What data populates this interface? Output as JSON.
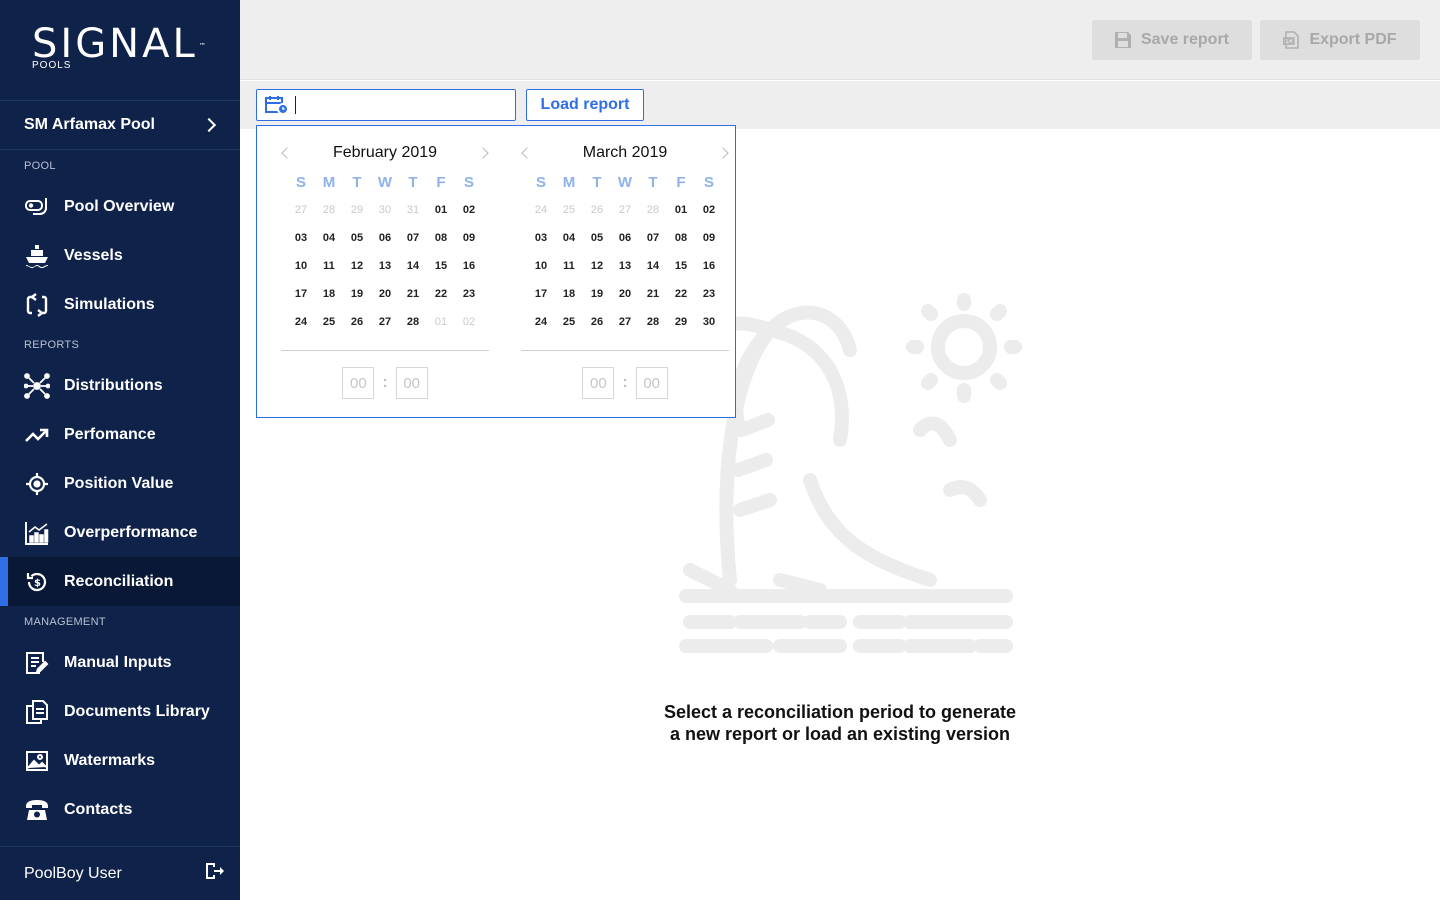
{
  "brand": {
    "name": "SIGNAL",
    "tm": "™",
    "sub": "POOLS"
  },
  "pool_selector": {
    "label": "SM Arfamax Pool"
  },
  "sidebar": {
    "sections": [
      {
        "label": "POOL",
        "items": [
          {
            "label": "Pool Overview",
            "icon": "snorkel-icon"
          },
          {
            "label": "Vessels",
            "icon": "ship-icon"
          },
          {
            "label": "Simulations",
            "icon": "cycle-icon"
          }
        ]
      },
      {
        "label": "REPORTS",
        "items": [
          {
            "label": "Distributions",
            "icon": "network-icon"
          },
          {
            "label": "Perfomance",
            "icon": "trend-icon"
          },
          {
            "label": "Position Value",
            "icon": "target-icon"
          },
          {
            "label": "Overperformance",
            "icon": "bar-chart-icon"
          },
          {
            "label": "Reconciliation",
            "icon": "reconcile-icon",
            "active": true
          }
        ]
      },
      {
        "label": "MANAGEMENT",
        "items": [
          {
            "label": "Manual Inputs",
            "icon": "edit-doc-icon"
          },
          {
            "label": "Documents Library",
            "icon": "documents-icon"
          },
          {
            "label": "Watermarks",
            "icon": "image-icon"
          },
          {
            "label": "Contacts",
            "icon": "phone-icon"
          }
        ]
      }
    ]
  },
  "user": {
    "name": "PoolBoy User"
  },
  "toolbar": {
    "save_label": "Save report",
    "export_label": "Export PDF"
  },
  "filter": {
    "date_value": "",
    "load_label": "Load report"
  },
  "calendar": {
    "dows": [
      "S",
      "M",
      "T",
      "W",
      "T",
      "F",
      "S"
    ],
    "months": [
      {
        "title": "February 2019",
        "weeks": [
          [
            [
              "27",
              1
            ],
            [
              "28",
              1
            ],
            [
              "29",
              1
            ],
            [
              "30",
              1
            ],
            [
              "31",
              1
            ],
            [
              "01",
              0
            ],
            [
              "02",
              0
            ]
          ],
          [
            [
              "03",
              0
            ],
            [
              "04",
              0
            ],
            [
              "05",
              0
            ],
            [
              "06",
              0
            ],
            [
              "07",
              0
            ],
            [
              "08",
              0
            ],
            [
              "09",
              0
            ]
          ],
          [
            [
              "10",
              0
            ],
            [
              "11",
              0
            ],
            [
              "12",
              0
            ],
            [
              "13",
              0
            ],
            [
              "14",
              0
            ],
            [
              "15",
              0
            ],
            [
              "16",
              0
            ]
          ],
          [
            [
              "17",
              0
            ],
            [
              "18",
              0
            ],
            [
              "19",
              0
            ],
            [
              "20",
              0
            ],
            [
              "21",
              0
            ],
            [
              "22",
              0
            ],
            [
              "23",
              0
            ]
          ],
          [
            [
              "24",
              0
            ],
            [
              "25",
              0
            ],
            [
              "26",
              0
            ],
            [
              "27",
              0
            ],
            [
              "28",
              0
            ],
            [
              "01",
              1
            ],
            [
              "02",
              1
            ]
          ]
        ],
        "time": {
          "hours": "00",
          "minutes": "00"
        }
      },
      {
        "title": "March 2019",
        "weeks": [
          [
            [
              "24",
              1
            ],
            [
              "25",
              1
            ],
            [
              "26",
              1
            ],
            [
              "27",
              1
            ],
            [
              "28",
              1
            ],
            [
              "01",
              0
            ],
            [
              "02",
              0
            ]
          ],
          [
            [
              "03",
              0
            ],
            [
              "04",
              0
            ],
            [
              "05",
              0
            ],
            [
              "06",
              0
            ],
            [
              "07",
              0
            ],
            [
              "08",
              0
            ],
            [
              "09",
              0
            ]
          ],
          [
            [
              "10",
              0
            ],
            [
              "11",
              0
            ],
            [
              "12",
              0
            ],
            [
              "13",
              0
            ],
            [
              "14",
              0
            ],
            [
              "15",
              0
            ],
            [
              "16",
              0
            ]
          ],
          [
            [
              "17",
              0
            ],
            [
              "18",
              0
            ],
            [
              "19",
              0
            ],
            [
              "20",
              0
            ],
            [
              "21",
              0
            ],
            [
              "22",
              0
            ],
            [
              "23",
              0
            ]
          ],
          [
            [
              "24",
              0
            ],
            [
              "25",
              0
            ],
            [
              "26",
              0
            ],
            [
              "27",
              0
            ],
            [
              "28",
              0
            ],
            [
              "29",
              0
            ],
            [
              "30",
              0
            ]
          ]
        ],
        "time": {
          "hours": "00",
          "minutes": "00"
        }
      }
    ]
  },
  "empty_state": {
    "line1": "Select a reconciliation period to generate",
    "line2": "a new report or load an existing version",
    "icon": "palm-beach-icon"
  },
  "colors": {
    "sidebar": "#0f2249",
    "accent": "#2f6ee5",
    "topbar": "#eeeeee"
  }
}
